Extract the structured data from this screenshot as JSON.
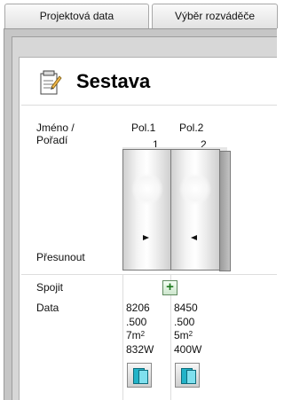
{
  "tabs": [
    {
      "label": "Projektová data"
    },
    {
      "label": "Výběr rozváděče"
    }
  ],
  "title": "Sestava",
  "labels": {
    "name_order_line1": "Jméno /",
    "name_order_line2": "Pořadí",
    "move": "Přesunout",
    "join": "Spojit",
    "data": "Data"
  },
  "icons": {
    "title": "notepad-pencil-icon",
    "join": "plus-icon",
    "document": "document-icon"
  },
  "colors": {
    "join_icon": "#1f7a1f",
    "document_icon": "#22b3c8"
  },
  "columns": [
    {
      "name": "Pol.1",
      "position": "1",
      "move_arrow": "right",
      "data": {
        "number": "8206",
        "value": ".500",
        "area": "7m",
        "area_exp": "2",
        "power": "832W"
      }
    },
    {
      "name": "Pol.2",
      "position": "2",
      "move_arrow": "left",
      "data": {
        "number": "8450",
        "value": ".500",
        "area": "5m",
        "area_exp": "2",
        "power": "400W"
      }
    }
  ]
}
